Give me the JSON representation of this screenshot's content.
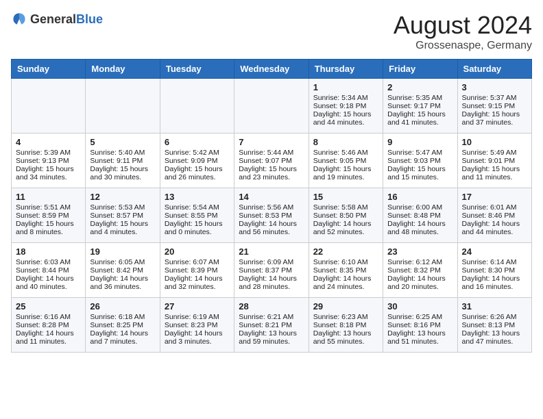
{
  "header": {
    "logo_general": "General",
    "logo_blue": "Blue",
    "month_year": "August 2024",
    "location": "Grossenaspe, Germany"
  },
  "days_of_week": [
    "Sunday",
    "Monday",
    "Tuesday",
    "Wednesday",
    "Thursday",
    "Friday",
    "Saturday"
  ],
  "weeks": [
    [
      {
        "day": "",
        "sunrise": "",
        "sunset": "",
        "daylight": ""
      },
      {
        "day": "",
        "sunrise": "",
        "sunset": "",
        "daylight": ""
      },
      {
        "day": "",
        "sunrise": "",
        "sunset": "",
        "daylight": ""
      },
      {
        "day": "",
        "sunrise": "",
        "sunset": "",
        "daylight": ""
      },
      {
        "day": "1",
        "sunrise": "Sunrise: 5:34 AM",
        "sunset": "Sunset: 9:18 PM",
        "daylight": "Daylight: 15 hours and 44 minutes."
      },
      {
        "day": "2",
        "sunrise": "Sunrise: 5:35 AM",
        "sunset": "Sunset: 9:17 PM",
        "daylight": "Daylight: 15 hours and 41 minutes."
      },
      {
        "day": "3",
        "sunrise": "Sunrise: 5:37 AM",
        "sunset": "Sunset: 9:15 PM",
        "daylight": "Daylight: 15 hours and 37 minutes."
      }
    ],
    [
      {
        "day": "4",
        "sunrise": "Sunrise: 5:39 AM",
        "sunset": "Sunset: 9:13 PM",
        "daylight": "Daylight: 15 hours and 34 minutes."
      },
      {
        "day": "5",
        "sunrise": "Sunrise: 5:40 AM",
        "sunset": "Sunset: 9:11 PM",
        "daylight": "Daylight: 15 hours and 30 minutes."
      },
      {
        "day": "6",
        "sunrise": "Sunrise: 5:42 AM",
        "sunset": "Sunset: 9:09 PM",
        "daylight": "Daylight: 15 hours and 26 minutes."
      },
      {
        "day": "7",
        "sunrise": "Sunrise: 5:44 AM",
        "sunset": "Sunset: 9:07 PM",
        "daylight": "Daylight: 15 hours and 23 minutes."
      },
      {
        "day": "8",
        "sunrise": "Sunrise: 5:46 AM",
        "sunset": "Sunset: 9:05 PM",
        "daylight": "Daylight: 15 hours and 19 minutes."
      },
      {
        "day": "9",
        "sunrise": "Sunrise: 5:47 AM",
        "sunset": "Sunset: 9:03 PM",
        "daylight": "Daylight: 15 hours and 15 minutes."
      },
      {
        "day": "10",
        "sunrise": "Sunrise: 5:49 AM",
        "sunset": "Sunset: 9:01 PM",
        "daylight": "Daylight: 15 hours and 11 minutes."
      }
    ],
    [
      {
        "day": "11",
        "sunrise": "Sunrise: 5:51 AM",
        "sunset": "Sunset: 8:59 PM",
        "daylight": "Daylight: 15 hours and 8 minutes."
      },
      {
        "day": "12",
        "sunrise": "Sunrise: 5:53 AM",
        "sunset": "Sunset: 8:57 PM",
        "daylight": "Daylight: 15 hours and 4 minutes."
      },
      {
        "day": "13",
        "sunrise": "Sunrise: 5:54 AM",
        "sunset": "Sunset: 8:55 PM",
        "daylight": "Daylight: 15 hours and 0 minutes."
      },
      {
        "day": "14",
        "sunrise": "Sunrise: 5:56 AM",
        "sunset": "Sunset: 8:53 PM",
        "daylight": "Daylight: 14 hours and 56 minutes."
      },
      {
        "day": "15",
        "sunrise": "Sunrise: 5:58 AM",
        "sunset": "Sunset: 8:50 PM",
        "daylight": "Daylight: 14 hours and 52 minutes."
      },
      {
        "day": "16",
        "sunrise": "Sunrise: 6:00 AM",
        "sunset": "Sunset: 8:48 PM",
        "daylight": "Daylight: 14 hours and 48 minutes."
      },
      {
        "day": "17",
        "sunrise": "Sunrise: 6:01 AM",
        "sunset": "Sunset: 8:46 PM",
        "daylight": "Daylight: 14 hours and 44 minutes."
      }
    ],
    [
      {
        "day": "18",
        "sunrise": "Sunrise: 6:03 AM",
        "sunset": "Sunset: 8:44 PM",
        "daylight": "Daylight: 14 hours and 40 minutes."
      },
      {
        "day": "19",
        "sunrise": "Sunrise: 6:05 AM",
        "sunset": "Sunset: 8:42 PM",
        "daylight": "Daylight: 14 hours and 36 minutes."
      },
      {
        "day": "20",
        "sunrise": "Sunrise: 6:07 AM",
        "sunset": "Sunset: 8:39 PM",
        "daylight": "Daylight: 14 hours and 32 minutes."
      },
      {
        "day": "21",
        "sunrise": "Sunrise: 6:09 AM",
        "sunset": "Sunset: 8:37 PM",
        "daylight": "Daylight: 14 hours and 28 minutes."
      },
      {
        "day": "22",
        "sunrise": "Sunrise: 6:10 AM",
        "sunset": "Sunset: 8:35 PM",
        "daylight": "Daylight: 14 hours and 24 minutes."
      },
      {
        "day": "23",
        "sunrise": "Sunrise: 6:12 AM",
        "sunset": "Sunset: 8:32 PM",
        "daylight": "Daylight: 14 hours and 20 minutes."
      },
      {
        "day": "24",
        "sunrise": "Sunrise: 6:14 AM",
        "sunset": "Sunset: 8:30 PM",
        "daylight": "Daylight: 14 hours and 16 minutes."
      }
    ],
    [
      {
        "day": "25",
        "sunrise": "Sunrise: 6:16 AM",
        "sunset": "Sunset: 8:28 PM",
        "daylight": "Daylight: 14 hours and 11 minutes."
      },
      {
        "day": "26",
        "sunrise": "Sunrise: 6:18 AM",
        "sunset": "Sunset: 8:25 PM",
        "daylight": "Daylight: 14 hours and 7 minutes."
      },
      {
        "day": "27",
        "sunrise": "Sunrise: 6:19 AM",
        "sunset": "Sunset: 8:23 PM",
        "daylight": "Daylight: 14 hours and 3 minutes."
      },
      {
        "day": "28",
        "sunrise": "Sunrise: 6:21 AM",
        "sunset": "Sunset: 8:21 PM",
        "daylight": "Daylight: 13 hours and 59 minutes."
      },
      {
        "day": "29",
        "sunrise": "Sunrise: 6:23 AM",
        "sunset": "Sunset: 8:18 PM",
        "daylight": "Daylight: 13 hours and 55 minutes."
      },
      {
        "day": "30",
        "sunrise": "Sunrise: 6:25 AM",
        "sunset": "Sunset: 8:16 PM",
        "daylight": "Daylight: 13 hours and 51 minutes."
      },
      {
        "day": "31",
        "sunrise": "Sunrise: 6:26 AM",
        "sunset": "Sunset: 8:13 PM",
        "daylight": "Daylight: 13 hours and 47 minutes."
      }
    ]
  ]
}
